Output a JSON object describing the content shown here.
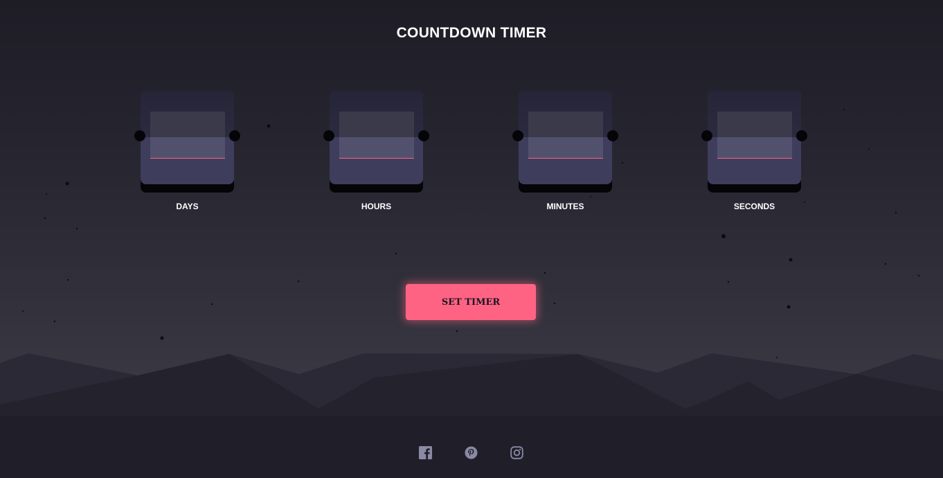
{
  "header": {
    "title": "COUNTDOWN TIMER"
  },
  "timer": {
    "units": [
      {
        "label": "DAYS",
        "value": ""
      },
      {
        "label": "HOURS",
        "value": ""
      },
      {
        "label": "MINUTES",
        "value": ""
      },
      {
        "label": "SECONDS",
        "value": ""
      }
    ]
  },
  "actions": {
    "set_timer_label": "SET TIMER"
  },
  "footer": {
    "socials": [
      {
        "name": "facebook-icon"
      },
      {
        "name": "pinterest-icon"
      },
      {
        "name": "instagram-icon"
      }
    ]
  },
  "colors": {
    "accent": "#ff6384",
    "background_top": "#1e1d26",
    "background_bottom": "#403f4b",
    "card": "#3e3d5c",
    "icon": "#8a89a6"
  }
}
